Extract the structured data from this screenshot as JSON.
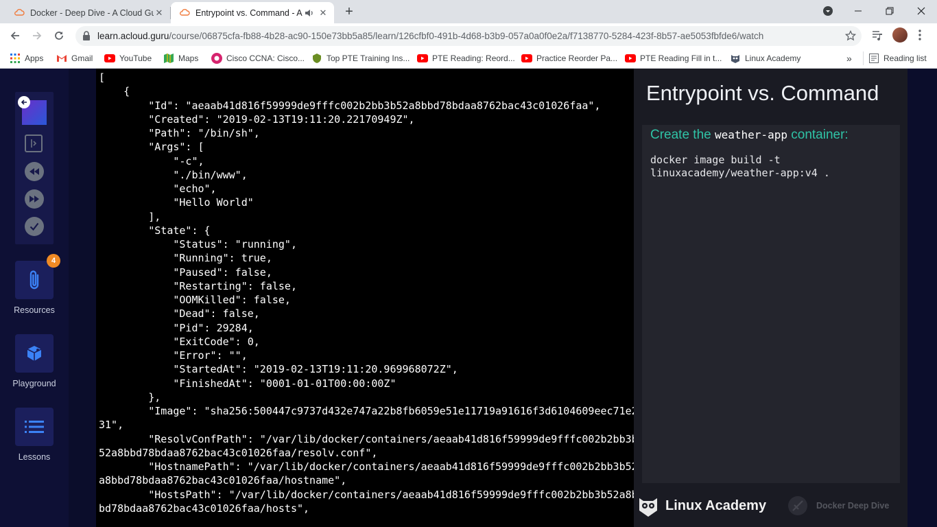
{
  "browser": {
    "tabs": [
      {
        "title": "Docker - Deep Dive - A Cloud Gu",
        "active": false
      },
      {
        "title": "Entrypoint vs. Command - A",
        "active": true
      }
    ],
    "url_host": "learn.acloud.guru",
    "url_path": "/course/06875cfa-fb88-4b28-ac90-150e73bb5a85/learn/126cfbf0-491b-4d68-b3b9-057a0a0f0e2a/f7138770-5284-423f-8b57-ae5053fbfde6/watch",
    "bookmarks": [
      {
        "label": "Apps",
        "icon": "apps-grid-icon"
      },
      {
        "label": "Gmail",
        "icon": "gmail-icon"
      },
      {
        "label": "YouTube",
        "icon": "youtube-icon"
      },
      {
        "label": "Maps",
        "icon": "maps-icon"
      },
      {
        "label": "Cisco CCNA: Cisco...",
        "icon": "cisco-icon"
      },
      {
        "label": "Top PTE Training Ins...",
        "icon": "pte-icon"
      },
      {
        "label": "PTE Reading: Reord...",
        "icon": "youtube-icon"
      },
      {
        "label": "Practice Reorder Pa...",
        "icon": "youtube-icon"
      },
      {
        "label": "PTE Reading Fill in t...",
        "icon": "youtube-icon"
      },
      {
        "label": "Linux Academy",
        "icon": "linux-academy-icon"
      }
    ],
    "reading_list": "Reading list"
  },
  "sidebar": {
    "resources_label": "Resources",
    "resources_badge": "4",
    "playground_label": "Playground",
    "lessons_label": "Lessons"
  },
  "terminal": {
    "lines": [
      "[",
      "    {",
      "        \"Id\": \"aeaab41d816f59999de9fffc002b2bb3b52a8bbd78bdaa8762bac43c01026faa\",",
      "        \"Created\": \"2019-02-13T19:11:20.22170949Z\",",
      "        \"Path\": \"/bin/sh\",",
      "        \"Args\": [",
      "            \"-c\",",
      "            \"./bin/www\",",
      "            \"echo\",",
      "            \"Hello World\"",
      "        ],",
      "        \"State\": {",
      "            \"Status\": \"running\",",
      "            \"Running\": true,",
      "            \"Paused\": false,",
      "            \"Restarting\": false,",
      "            \"OOMKilled\": false,",
      "            \"Dead\": false,",
      "            \"Pid\": 29284,",
      "            \"ExitCode\": 0,",
      "            \"Error\": \"\",",
      "            \"StartedAt\": \"2019-02-13T19:11:20.969968072Z\",",
      "            \"FinishedAt\": \"0001-01-01T00:00:00Z\"",
      "        },",
      "        \"Image\": \"sha256:500447c9737d432e747a22b8fb6059e51e11719a91616f3d6104609eec71e2",
      "31\",",
      "        \"ResolvConfPath\": \"/var/lib/docker/containers/aeaab41d816f59999de9fffc002b2bb3b",
      "52a8bbd78bdaa8762bac43c01026faa/resolv.conf\",",
      "        \"HostnamePath\": \"/var/lib/docker/containers/aeaab41d816f59999de9fffc002b2bb3b52",
      "a8bbd78bdaa8762bac43c01026faa/hostname\",",
      "        \"HostsPath\": \"/var/lib/docker/containers/aeaab41d816f59999de9fffc002b2bb3b52a8b",
      "bd78bdaa8762bac43c01026faa/hosts\","
    ]
  },
  "slide": {
    "title": "Entrypoint vs. Command",
    "heading_prefix": "Create the ",
    "heading_code": "weather-app",
    "heading_suffix": " container:",
    "code": "docker image build -t\nlinuxacademy/weather-app:v4 .",
    "brand": "Linux Academy",
    "course": "Docker Deep Dive"
  },
  "colors": {
    "accent_green": "#2fc3a6",
    "badge_orange": "#f08a24",
    "sidebar_tile": "#1b1f5c"
  }
}
